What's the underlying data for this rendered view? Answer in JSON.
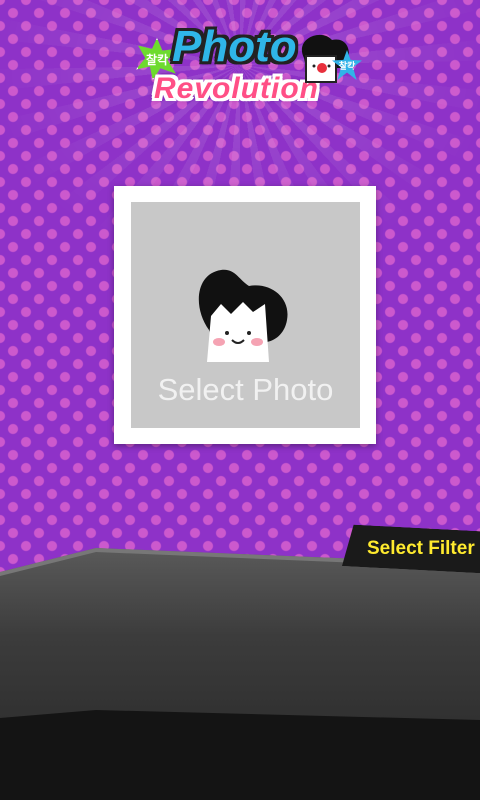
{
  "app": {
    "logo_line1": "Photo",
    "logo_line2": "Revolution",
    "logo_badge_left": "찰칵",
    "logo_badge_right": "찰칵"
  },
  "photo_picker": {
    "label": "Select Photo",
    "placeholder_icon": "mascot-face-icon"
  },
  "filter_tab": {
    "label": "Select Filter"
  },
  "colors": {
    "background": "#8e32c8",
    "dots": "#ff78d2",
    "accent_yellow": "#ffea2e",
    "panel_dark": "#2a2a2a"
  }
}
